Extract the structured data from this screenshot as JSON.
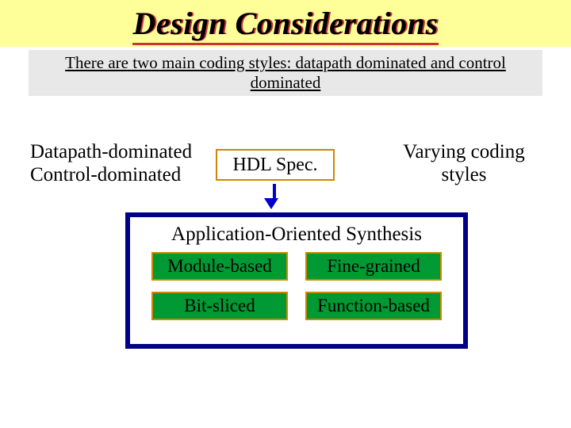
{
  "slide": {
    "title": "Design Considerations",
    "subtitle": "There are two main coding styles: datapath dominated and control dominated",
    "left_list": {
      "line1": "Datapath-dominated",
      "line2": "Control-dominated"
    },
    "hdl_box": "HDL Spec.",
    "right_text": {
      "line1": "Varying coding",
      "line2": "styles"
    },
    "synthesis": {
      "heading": "Application-Oriented Synthesis",
      "boxes": {
        "tl": "Module-based",
        "tr": "Fine-grained",
        "bl": "Bit-sliced",
        "br": "Function-based"
      }
    }
  }
}
